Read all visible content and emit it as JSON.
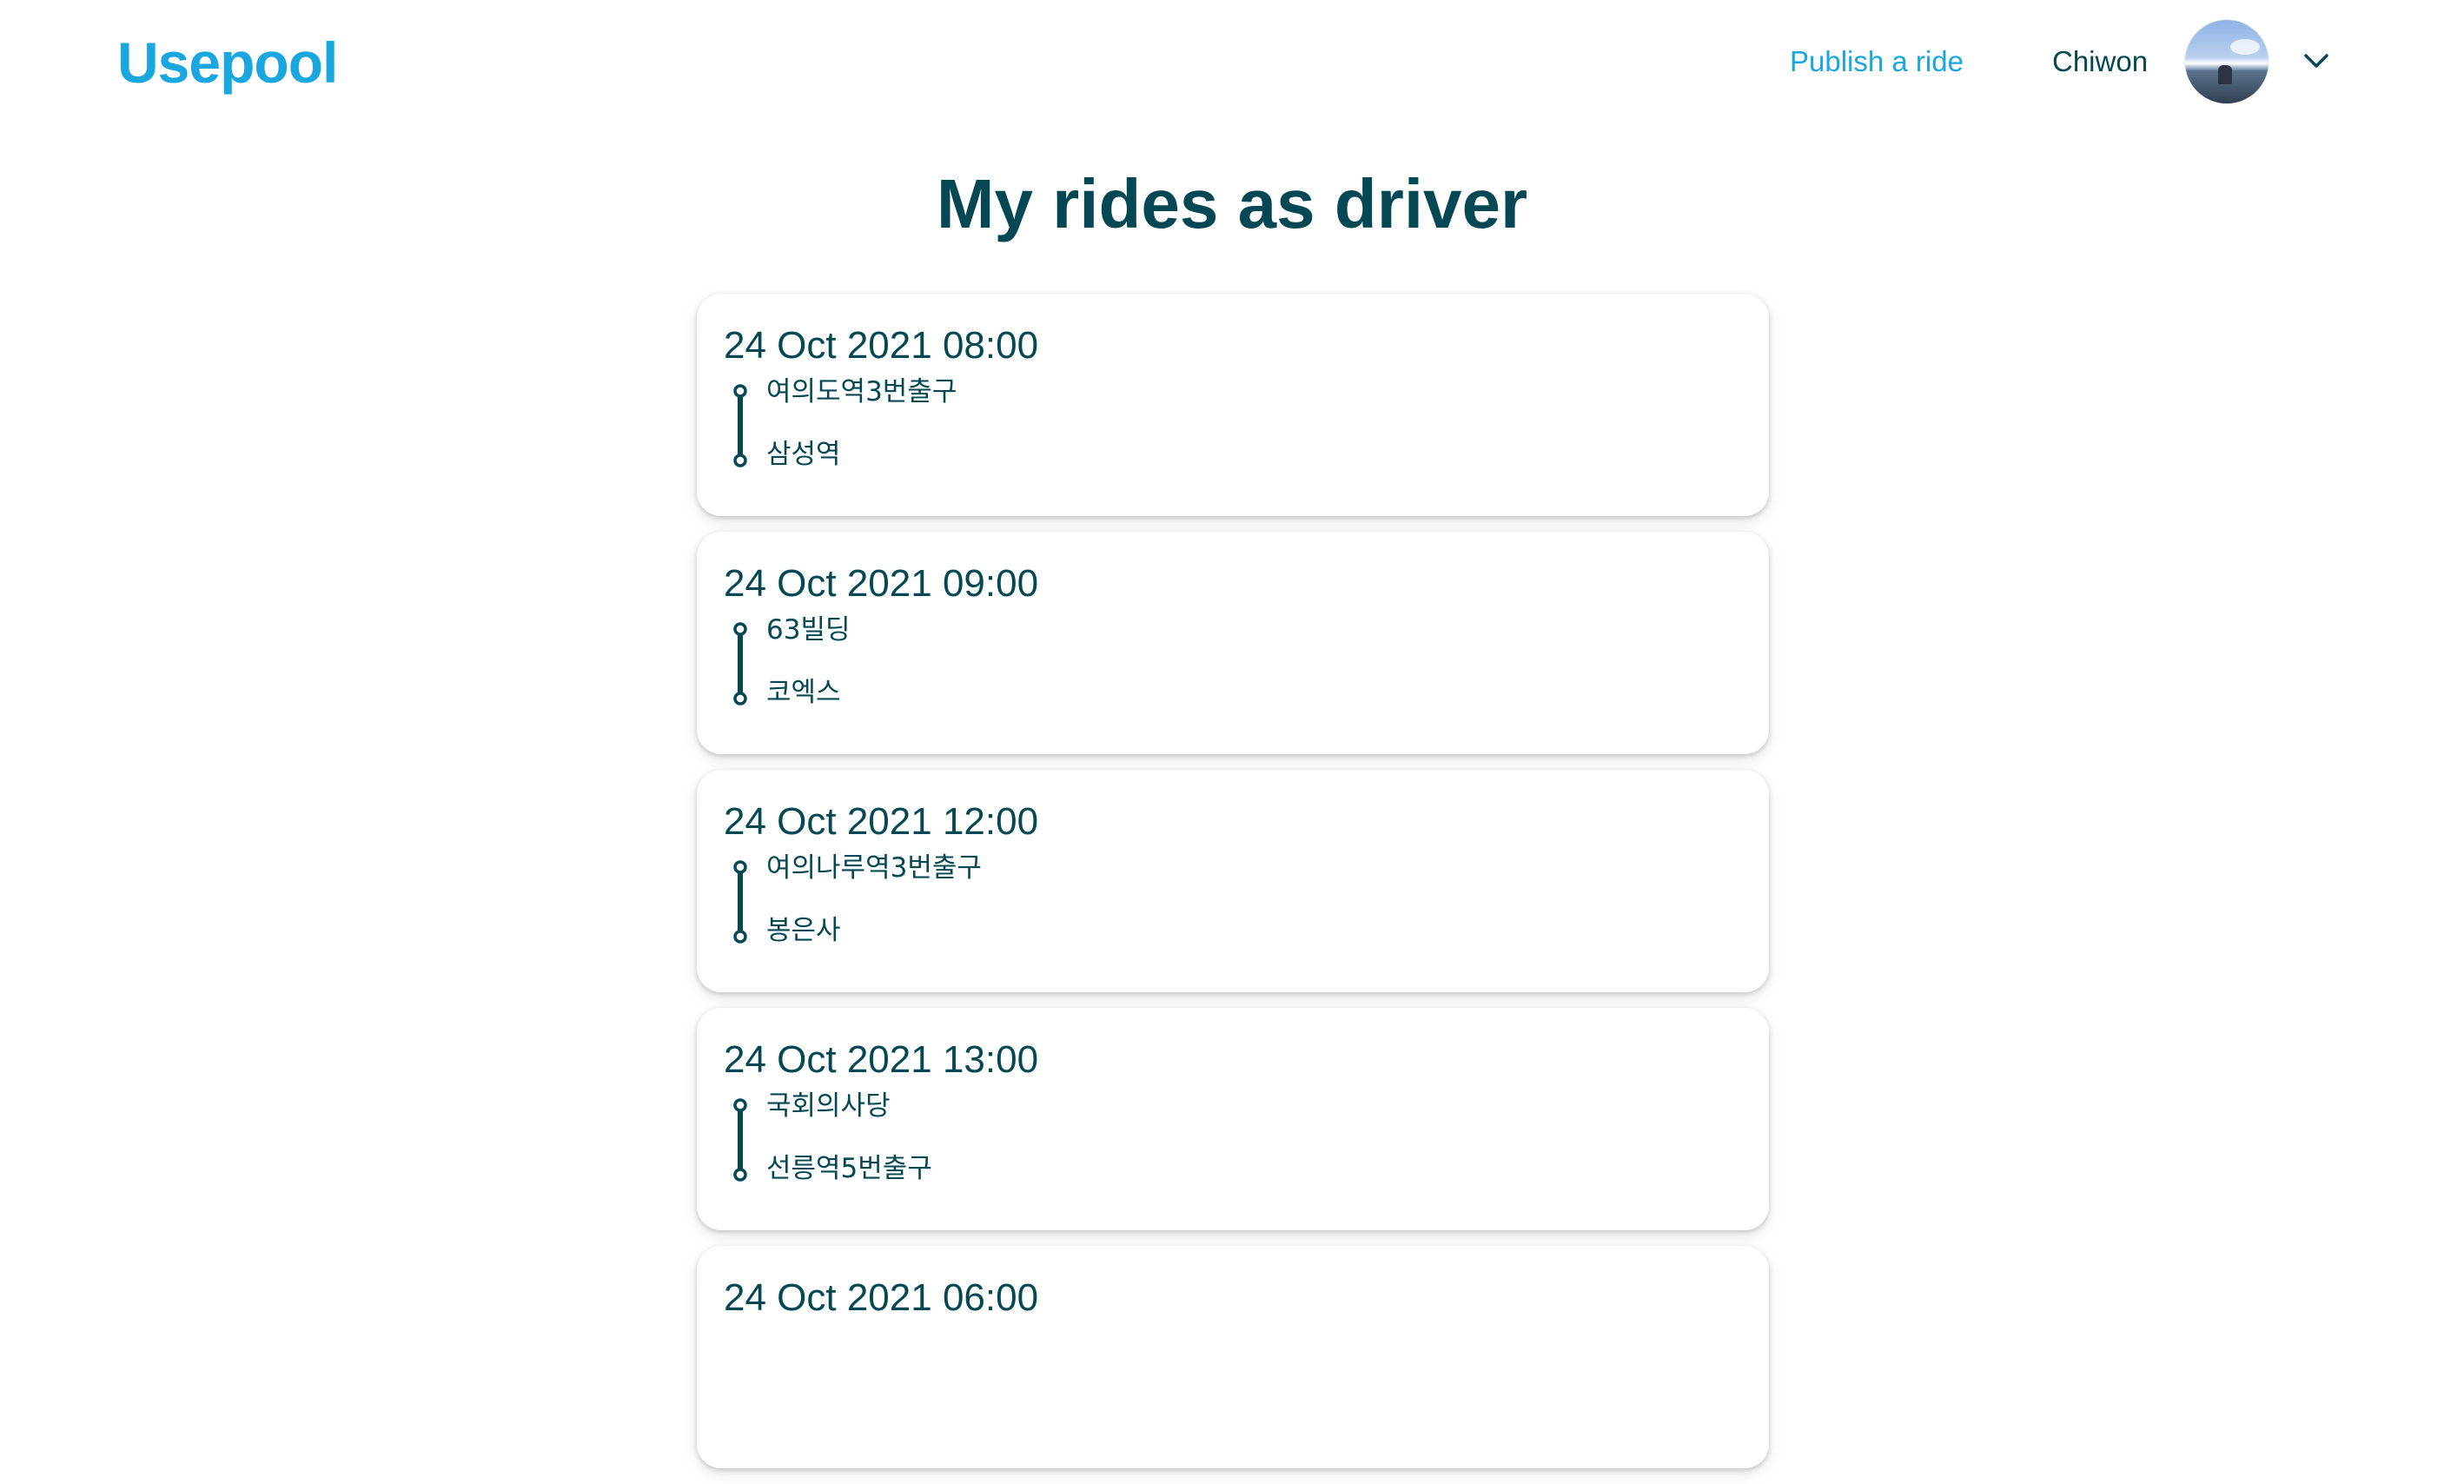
{
  "header": {
    "logo": "Usepool",
    "publish_label": "Publish a ride",
    "user_name": "Chiwon",
    "avatar_icon": "user-avatar-photo",
    "menu_icon": "chevron-down-icon"
  },
  "page": {
    "title": "My rides as driver"
  },
  "rides": [
    {
      "datetime": "24 Oct 2021 08:00",
      "from": "여의도역3번출구",
      "to": "삼성역"
    },
    {
      "datetime": "24 Oct 2021 09:00",
      "from": "63빌딩",
      "to": "코엑스"
    },
    {
      "datetime": "24 Oct 2021 12:00",
      "from": "여의나루역3번출구",
      "to": "봉은사"
    },
    {
      "datetime": "24 Oct 2021 13:00",
      "from": "국회의사당",
      "to": "선릉역5번출구"
    },
    {
      "datetime": "24 Oct 2021 06:00"
    }
  ],
  "colors": {
    "brand": "#1aa6df",
    "text": "#054752"
  }
}
